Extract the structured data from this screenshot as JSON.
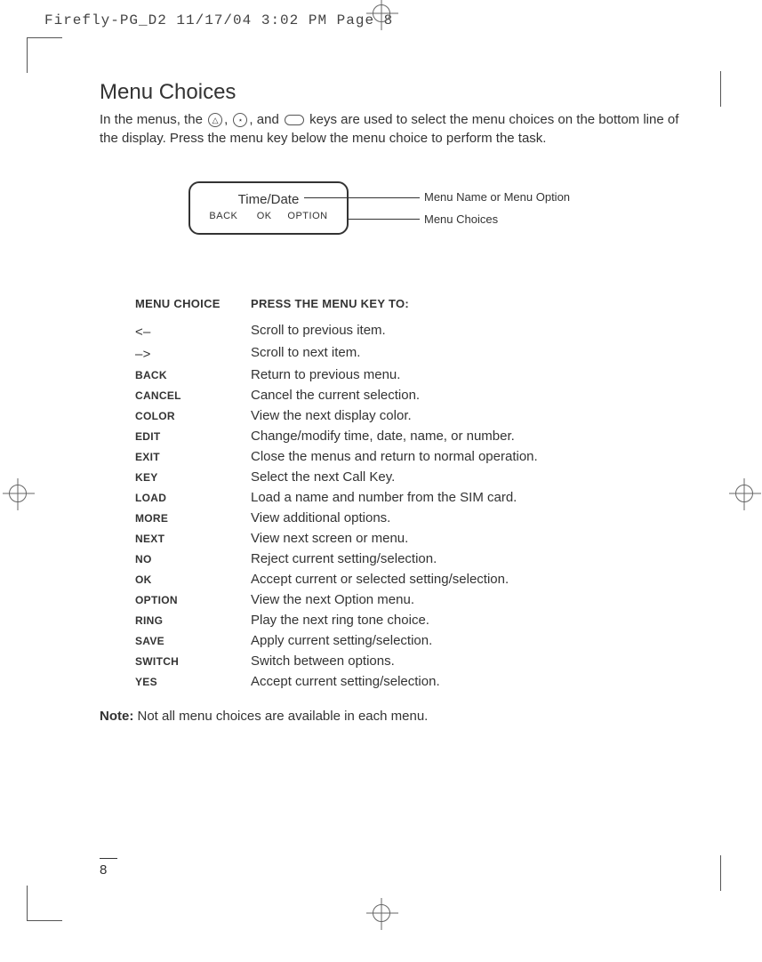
{
  "header": "Firefly-PG_D2  11/17/04  3:02 PM  Page 8",
  "page_number": "8",
  "title": "Menu Choices",
  "intro_parts": {
    "p1": "In the menus, the ",
    "p2": ",  ",
    "p3": ", and ",
    "p4": " keys are used to select the menu choices on the bottom line of the display. Press the menu key below the menu choice to perform the task."
  },
  "diagram": {
    "top": "Time/Date",
    "bottom_left": "BACK",
    "bottom_mid": "OK",
    "bottom_right": "OPTION",
    "callout1": "Menu Name or Menu Option",
    "callout2": "Menu Choices"
  },
  "table_header": {
    "col1": "MENU CHOICE",
    "col2": "PRESS THE MENU KEY TO:"
  },
  "rows": [
    {
      "choice": "<–",
      "symbol": true,
      "desc": "Scroll to previous item."
    },
    {
      "choice": "–>",
      "symbol": true,
      "desc": "Scroll to next item."
    },
    {
      "choice": "BACK",
      "desc": "Return to previous menu."
    },
    {
      "choice": "CANCEL",
      "desc": "Cancel the current selection."
    },
    {
      "choice": "COLOR",
      "desc": "View the next display color."
    },
    {
      "choice": "EDIT",
      "desc": "Change/modify time, date, name, or number."
    },
    {
      "choice": "EXIT",
      "desc": "Close the menus and return to normal operation."
    },
    {
      "choice": "KEY",
      "desc": "Select the next Call Key."
    },
    {
      "choice": "LOAD",
      "desc": "Load a name and number from the SIM card."
    },
    {
      "choice": "MORE",
      "desc": "View additional options."
    },
    {
      "choice": "NEXT",
      "desc": "View next screen or menu."
    },
    {
      "choice": "NO",
      "desc": "Reject current setting/selection."
    },
    {
      "choice": "OK",
      "desc": "Accept current or selected setting/selection."
    },
    {
      "choice": "OPTION",
      "desc": "View the next Option menu."
    },
    {
      "choice": "RING",
      "desc": "Play the next ring tone choice."
    },
    {
      "choice": "SAVE",
      "desc": "Apply current setting/selection."
    },
    {
      "choice": "SWITCH",
      "desc": "Switch between options."
    },
    {
      "choice": "YES",
      "desc": "Accept current setting/selection."
    }
  ],
  "note": {
    "label": "Note:",
    "text": "  Not all menu choices are available in each menu."
  }
}
